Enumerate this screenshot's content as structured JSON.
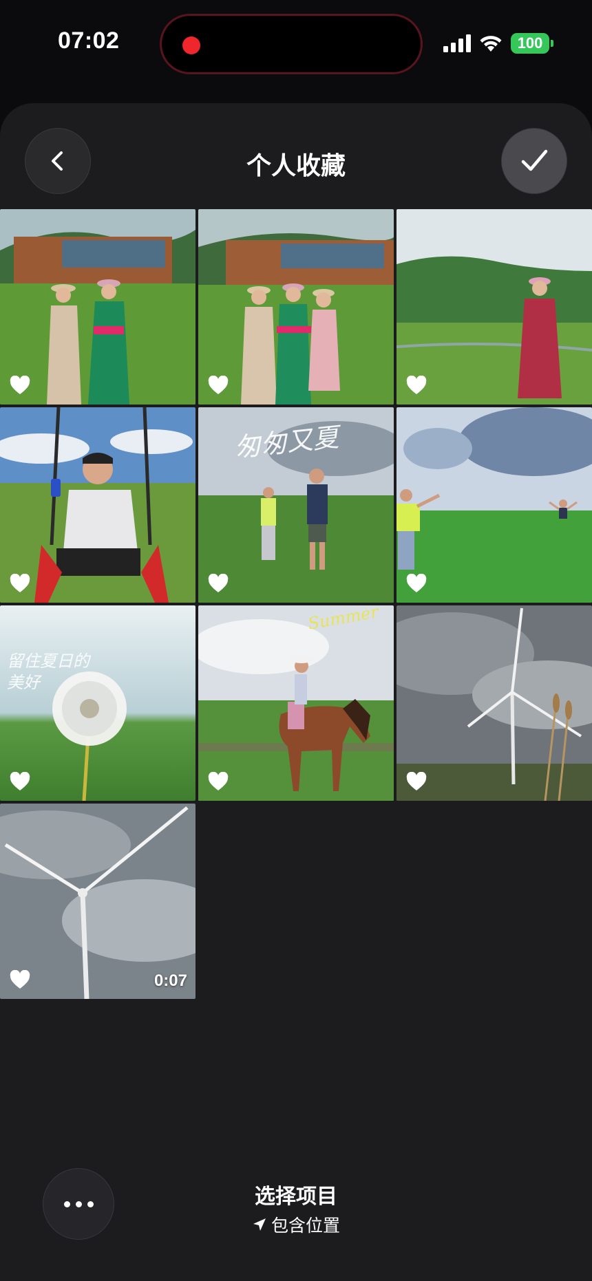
{
  "status_bar": {
    "time": "07:02",
    "battery": "100",
    "battery_color": "#35c759",
    "recording_indicator_color": "#f0262d",
    "icons": [
      "signal-icon",
      "wifi-icon",
      "battery-icon"
    ]
  },
  "header": {
    "title": "个人收藏",
    "back_icon": "chevron-left-icon",
    "done_icon": "checkmark-icon"
  },
  "photos": [
    {
      "kind": "photo",
      "favorite": true,
      "scene": "two-women-mongolian-robes-building"
    },
    {
      "kind": "photo",
      "favorite": true,
      "scene": "three-women-mongolian-robes-building"
    },
    {
      "kind": "photo",
      "favorite": true,
      "scene": "woman-red-dress-hills"
    },
    {
      "kind": "photo",
      "favorite": true,
      "scene": "man-on-swing"
    },
    {
      "kind": "photo",
      "favorite": true,
      "scene": "two-boys-grassland",
      "overlay_text": "匆匆又夏"
    },
    {
      "kind": "photo",
      "favorite": true,
      "scene": "two-people-waving-grassland"
    },
    {
      "kind": "photo",
      "favorite": true,
      "scene": "dandelion-closeup",
      "overlay_text": "留住夏日的美好"
    },
    {
      "kind": "photo",
      "favorite": true,
      "scene": "woman-riding-horse",
      "overlay_text": "Summer"
    },
    {
      "kind": "photo",
      "favorite": true,
      "scene": "wind-turbine-cloudy-sky"
    },
    {
      "kind": "video",
      "favorite": true,
      "scene": "wind-turbine-closeup",
      "duration": "0:07"
    }
  ],
  "bottom_bar": {
    "select_label": "选择项目",
    "location_label": "包含位置",
    "more_icon": "ellipsis-icon",
    "location_icon": "location-arrow-icon"
  }
}
